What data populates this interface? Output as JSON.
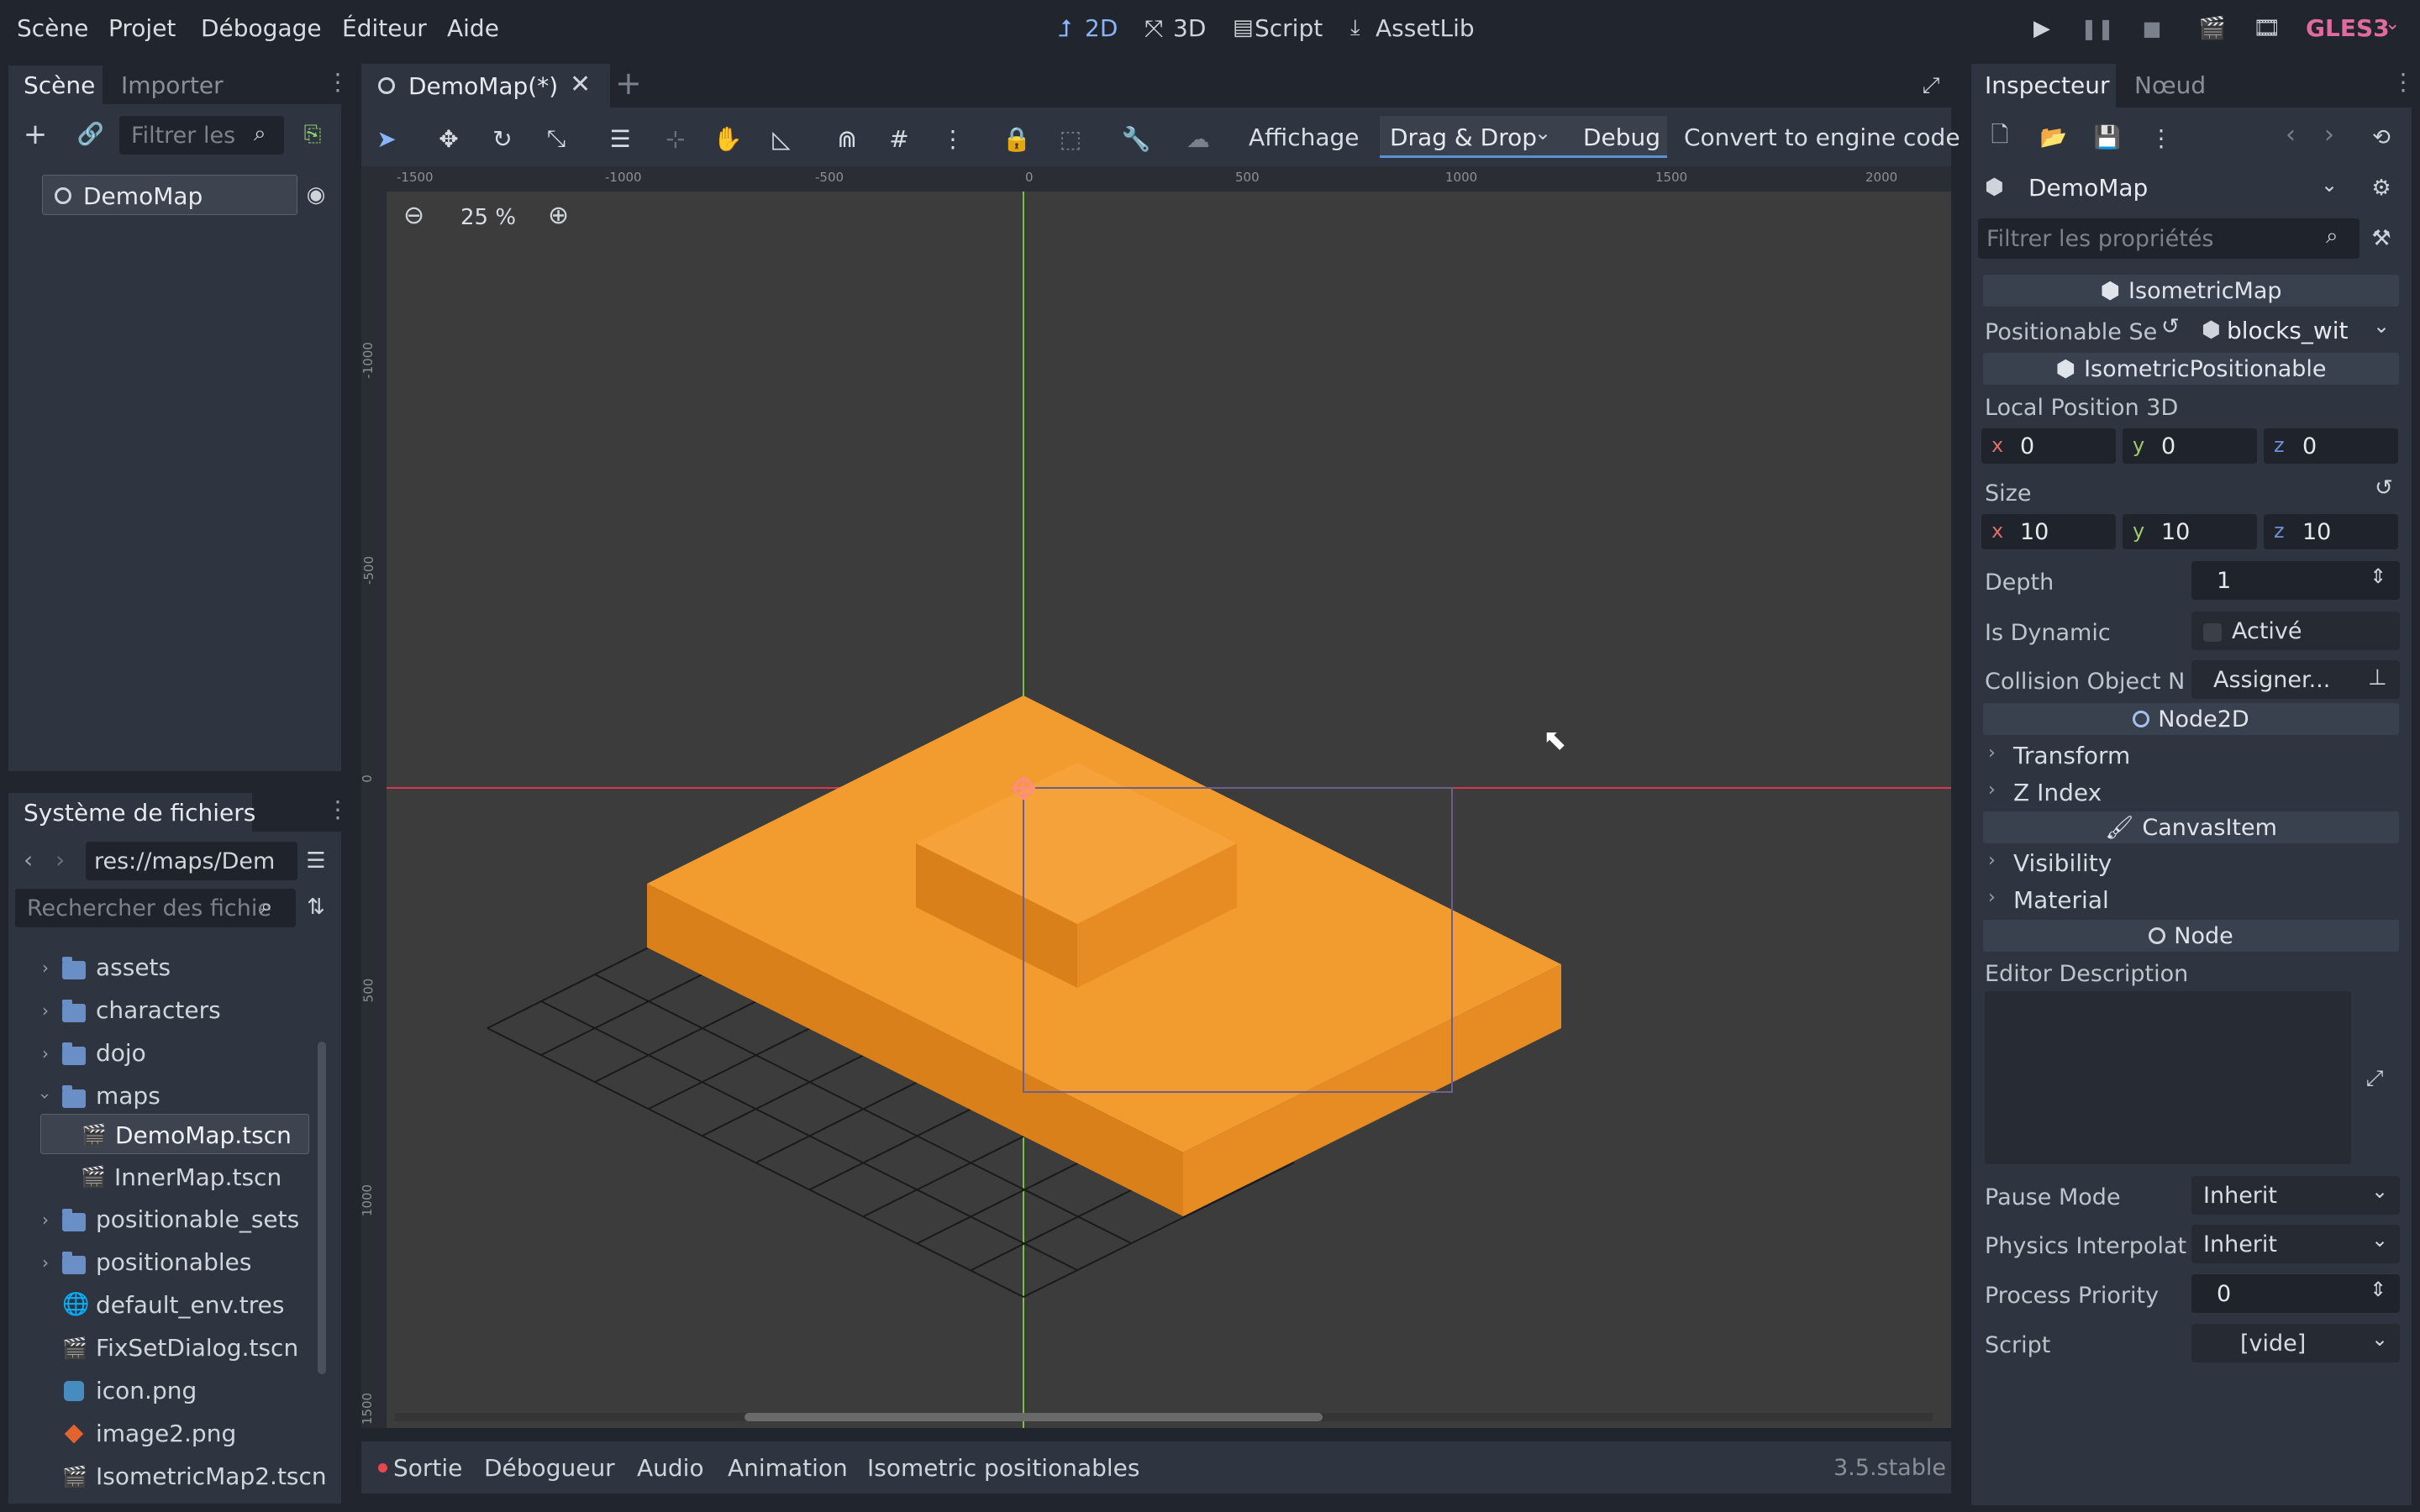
{
  "menu": {
    "items": [
      "Scène",
      "Projet",
      "Débogage",
      "Éditeur",
      "Aide"
    ]
  },
  "workspaces": {
    "items": [
      "2D",
      "3D",
      "Script",
      "AssetLib"
    ],
    "active": "2D"
  },
  "renderer": "GLES3",
  "scene_dock": {
    "tabs": [
      "Scène",
      "Importer"
    ],
    "filter_placeholder": "Filtrer les",
    "root_node": "DemoMap"
  },
  "filesystem": {
    "title": "Système de fichiers",
    "path": "res://maps/Dem",
    "search_placeholder": "Rechercher des fichie",
    "items": [
      {
        "name": "assets",
        "type": "folder",
        "collapsed": true
      },
      {
        "name": "characters",
        "type": "folder",
        "collapsed": true
      },
      {
        "name": "dojo",
        "type": "folder",
        "collapsed": true
      },
      {
        "name": "maps",
        "type": "folder",
        "collapsed": false
      },
      {
        "name": "DemoMap.tscn",
        "type": "scene",
        "child": true
      },
      {
        "name": "InnerMap.tscn",
        "type": "scene",
        "child": true
      },
      {
        "name": "positionable_sets",
        "type": "folder",
        "collapsed": true
      },
      {
        "name": "positionables",
        "type": "folder",
        "collapsed": true
      },
      {
        "name": "default_env.tres",
        "type": "env"
      },
      {
        "name": "FixSetDialog.tscn",
        "type": "scene"
      },
      {
        "name": "icon.png",
        "type": "image"
      },
      {
        "name": "image2.png",
        "type": "image2"
      },
      {
        "name": "IsometricMap2.tscn",
        "type": "scene"
      }
    ],
    "selected": "DemoMap.tscn"
  },
  "editor": {
    "tab_label": "DemoMap(*)",
    "toolbar": {
      "view": "Affichage",
      "dragdrop": "Drag & Drop",
      "debug": "Debug",
      "convert": "Convert to engine code"
    },
    "zoom": "25 %",
    "ruler_x": [
      "-1500",
      "-1000",
      "-500",
      "0",
      "500",
      "1000",
      "1500",
      "2000"
    ],
    "ruler_y": [
      "-1000",
      "-500",
      "0",
      "500",
      "1000",
      "1500"
    ]
  },
  "bottom_panel": {
    "tabs": [
      "Sortie",
      "Débogueur",
      "Audio",
      "Animation",
      "Isometric positionables"
    ],
    "version": "3.5.stable"
  },
  "inspector": {
    "tabs": [
      "Inspecteur",
      "Nœud"
    ],
    "object": "DemoMap",
    "filter_placeholder": "Filtrer les propriétés",
    "sections": {
      "isometric_map": "IsometricMap",
      "isometric_positionable": "IsometricPositionable",
      "node2d": "Node2D",
      "canvas_item": "CanvasItem",
      "node": "Node"
    },
    "positionable_set_label": "Positionable Se",
    "positionable_set_value": "blocks_wit",
    "local_position_label": "Local Position 3D",
    "local_position": {
      "x": "0",
      "y": "0",
      "z": "0"
    },
    "size_label": "Size",
    "size": {
      "x": "10",
      "y": "10",
      "z": "10"
    },
    "depth_label": "Depth",
    "depth": "1",
    "is_dynamic_label": "Is Dynamic",
    "is_dynamic_value": "Activé",
    "collision_label": "Collision Object N",
    "collision_value": "Assigner...",
    "transform": "Transform",
    "zindex": "Z Index",
    "visibility": "Visibility",
    "material": "Material",
    "editor_description": "Editor Description",
    "pause_mode_label": "Pause Mode",
    "pause_mode": "Inherit",
    "physics_label": "Physics Interpolat",
    "physics": "Inherit",
    "priority_label": "Process Priority",
    "priority": "0",
    "script_label": "Script",
    "script": "[vide]"
  }
}
